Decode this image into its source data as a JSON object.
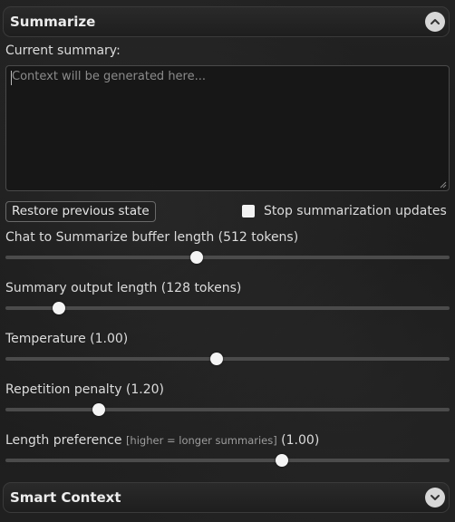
{
  "summarize": {
    "header": {
      "title": "Summarize",
      "toggle_icon": "chevron-up-icon"
    },
    "current_summary_label": "Current summary:",
    "summary_placeholder": "Context will be generated here...",
    "restore_button": "Restore previous state",
    "stop_updates_label": "Stop summarization updates",
    "stop_updates_checked": false,
    "sliders": [
      {
        "key": "buffer",
        "label": "Chat to Summarize buffer length (512 tokens)",
        "hint": "",
        "value_text": "",
        "fraction": 0.43
      },
      {
        "key": "output",
        "label": "Summary output length (128 tokens)",
        "hint": "",
        "value_text": "",
        "fraction": 0.12
      },
      {
        "key": "temperature",
        "label": "Temperature (1.00)",
        "hint": "",
        "value_text": "",
        "fraction": 0.475
      },
      {
        "key": "repetition",
        "label": "Repetition penalty (1.20)",
        "hint": "",
        "value_text": "",
        "fraction": 0.21
      },
      {
        "key": "length",
        "label": "Length preference ",
        "hint": "[higher = longer summaries]",
        "value_text": " (1.00)",
        "fraction": 0.623
      }
    ]
  },
  "smart_context": {
    "header": {
      "title": "Smart Context",
      "toggle_icon": "chevron-down-icon"
    }
  }
}
